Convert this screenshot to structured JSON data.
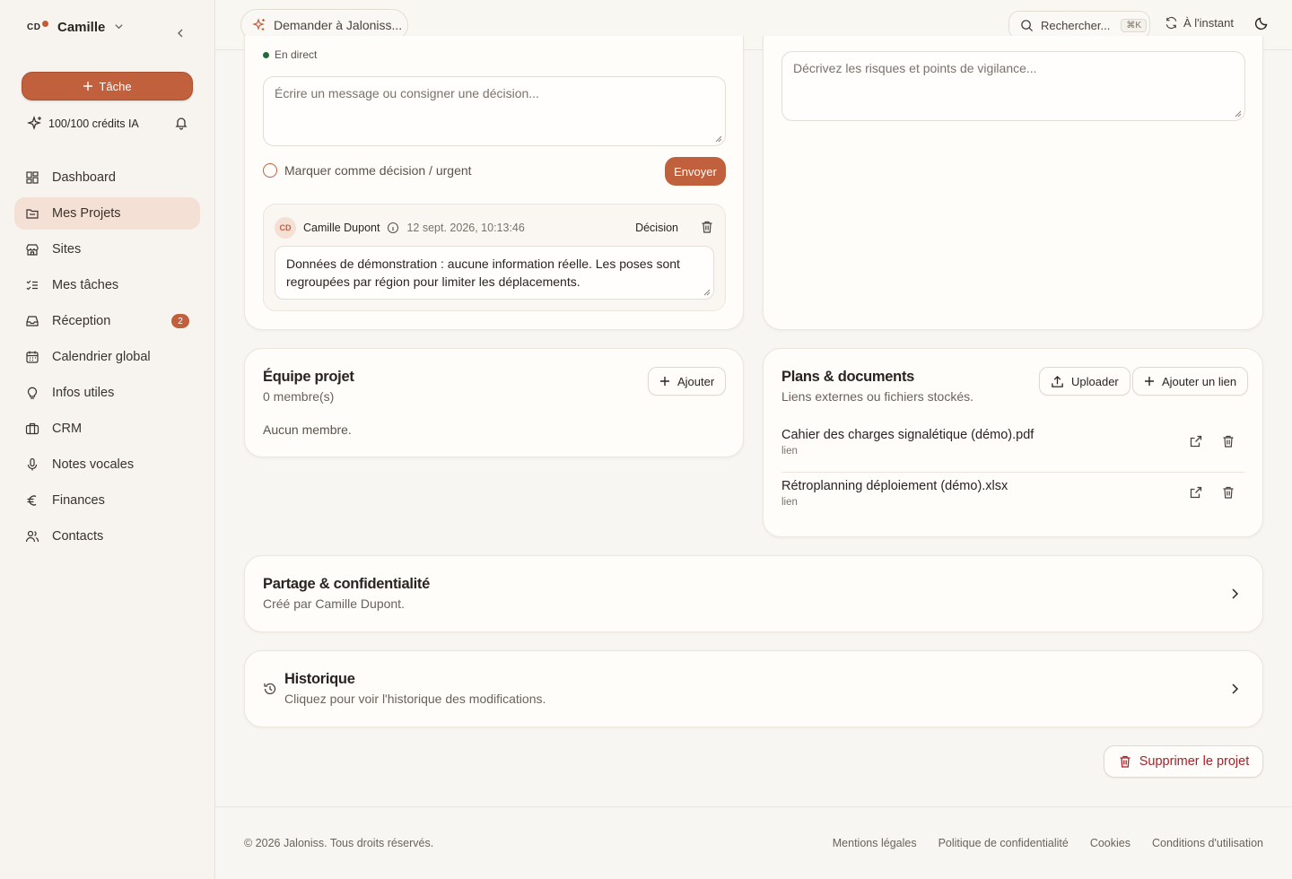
{
  "user": {
    "initials": "CD",
    "name": "Camille"
  },
  "sidebar": {
    "task_button": "Tâche",
    "credits": "100/100 crédits IA",
    "items": [
      {
        "label": "Dashboard",
        "icon": "dashboard-icon"
      },
      {
        "label": "Mes Projets",
        "icon": "folder-icon",
        "active": true
      },
      {
        "label": "Sites",
        "icon": "store-icon"
      },
      {
        "label": "Mes tâches",
        "icon": "checklist-icon"
      },
      {
        "label": "Réception",
        "icon": "inbox-icon",
        "badge": "2"
      },
      {
        "label": "Calendrier global",
        "icon": "calendar-icon"
      },
      {
        "label": "Infos utiles",
        "icon": "lightbulb-icon"
      },
      {
        "label": "CRM",
        "icon": "briefcase-icon"
      },
      {
        "label": "Notes vocales",
        "icon": "mic-icon"
      },
      {
        "label": "Finances",
        "icon": "euro-icon"
      },
      {
        "label": "Contacts",
        "icon": "users-icon"
      }
    ]
  },
  "header": {
    "ask": "Demander à Jaloniss...",
    "search": "Rechercher...",
    "shortcut": "⌘K",
    "sync": "À l'instant"
  },
  "discussion": {
    "live": "En direct",
    "message_placeholder": "Écrire un message ou consigner une décision...",
    "mark_label": "Marquer comme décision / urgent",
    "send": "Envoyer",
    "message": {
      "initials": "CD",
      "author": "Camille Dupont",
      "date": "12 sept. 2026, 10:13:46",
      "tag": "Décision",
      "text": "Données de démonstration : aucune information réelle. Les poses sont regroupées par région pour limiter les déplacements."
    }
  },
  "risks": {
    "placeholder": "Décrivez les risques et points de vigilance..."
  },
  "team": {
    "title": "Équipe projet",
    "count": "0 membre(s)",
    "add": "Ajouter",
    "empty": "Aucun membre."
  },
  "plans": {
    "title": "Plans & documents",
    "subtitle": "Liens externes ou fichiers stockés.",
    "upload": "Uploader",
    "add_link": "Ajouter un lien",
    "docs": [
      {
        "name": "Cahier des charges signalétique (démo).pdf",
        "type": "lien"
      },
      {
        "name": "Rétroplanning déploiement (démo).xlsx",
        "type": "lien"
      }
    ]
  },
  "sharing": {
    "title": "Partage & confidentialité",
    "subtitle": "Créé par Camille Dupont."
  },
  "history": {
    "title": "Historique",
    "subtitle": "Cliquez pour voir l'historique des modifications."
  },
  "delete_project": "Supprimer le projet",
  "footer": {
    "copyright": "© 2026 Jaloniss. Tous droits réservés.",
    "links": [
      "Mentions légales",
      "Politique de confidentialité",
      "Cookies",
      "Conditions d'utilisation"
    ]
  },
  "colors": {
    "accent": "#c0603d",
    "active_bg": "#f4e0d4",
    "danger": "#a8202a",
    "live": "#1f6b3b"
  }
}
